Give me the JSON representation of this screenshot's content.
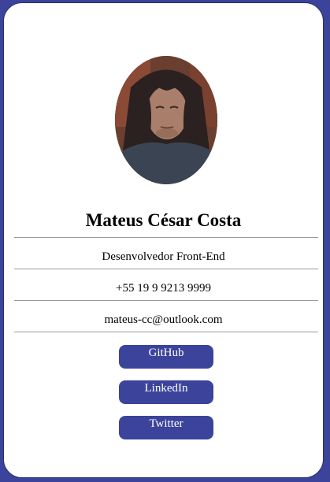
{
  "profile": {
    "name": "Mateus César Costa",
    "role": "Desenvolvedor Front-End",
    "phone": "+55 19 9 9213 9999",
    "email": "mateus-cc@outlook.com"
  },
  "links": {
    "github_label": "GitHub",
    "linkedin_label": "LinkedIn",
    "twitter_label": "Twitter"
  },
  "colors": {
    "background": "#3c439b",
    "card": "#ffffff",
    "button": "#3c439b",
    "button_text": "#ffffff",
    "divider": "#999999"
  }
}
